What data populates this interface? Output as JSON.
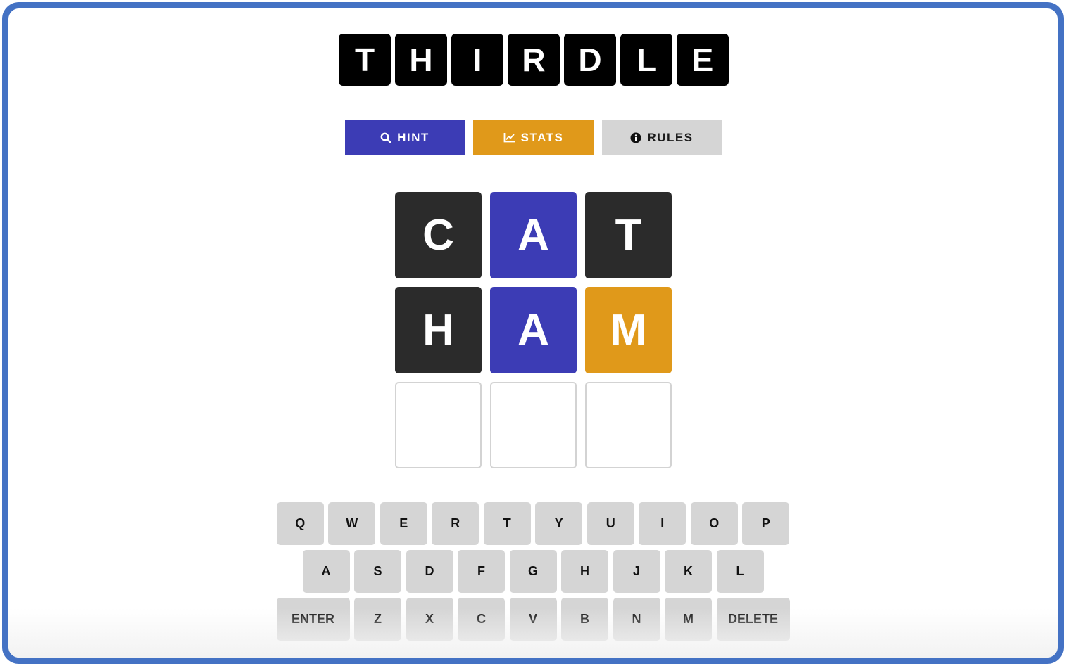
{
  "title_letters": [
    "T",
    "H",
    "I",
    "R",
    "D",
    "L",
    "E"
  ],
  "menu": {
    "hint_label": "HINT",
    "stats_label": "STATS",
    "rules_label": "RULES"
  },
  "icons": {
    "hint": "search-icon",
    "stats": "chart-line-icon",
    "rules": "info-circle-icon"
  },
  "colors": {
    "correct": "#3c3cb5",
    "present": "#e0991a",
    "absent": "#2b2b2b",
    "key": "#d5d5d5",
    "frame_border": "#4472c4"
  },
  "board": [
    [
      {
        "letter": "C",
        "state": "absent"
      },
      {
        "letter": "A",
        "state": "correct"
      },
      {
        "letter": "T",
        "state": "absent"
      }
    ],
    [
      {
        "letter": "H",
        "state": "absent"
      },
      {
        "letter": "A",
        "state": "correct"
      },
      {
        "letter": "M",
        "state": "present"
      }
    ],
    [
      {
        "letter": "",
        "state": "empty"
      },
      {
        "letter": "",
        "state": "empty"
      },
      {
        "letter": "",
        "state": "empty"
      }
    ]
  ],
  "keyboard": [
    [
      "Q",
      "W",
      "E",
      "R",
      "T",
      "Y",
      "U",
      "I",
      "O",
      "P"
    ],
    [
      "A",
      "S",
      "D",
      "F",
      "G",
      "H",
      "J",
      "K",
      "L"
    ],
    [
      "ENTER",
      "Z",
      "X",
      "C",
      "V",
      "B",
      "N",
      "M",
      "DELETE"
    ]
  ]
}
